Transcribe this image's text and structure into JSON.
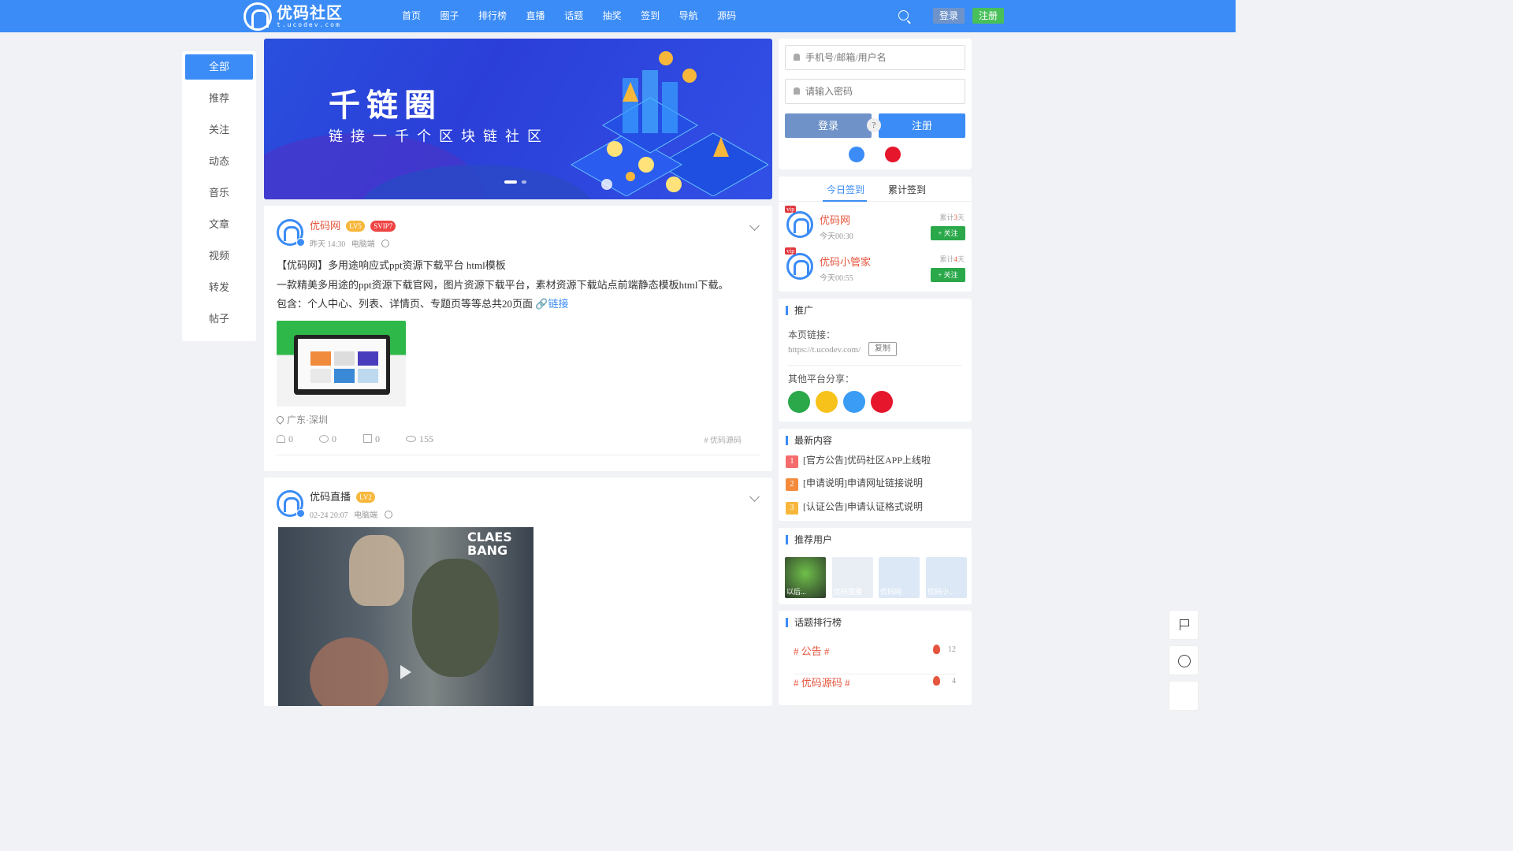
{
  "site": {
    "logo_title": "优码社区",
    "logo_sub": "t.ucodev.com",
    "nav": [
      "首页",
      "圈子",
      "排行榜",
      "直播",
      "话题",
      "抽奖",
      "签到",
      "导航",
      "源码"
    ],
    "login_label": "登录",
    "register_label": "注册",
    "accent": "#3b8cf6"
  },
  "left_nav": {
    "items": [
      "全部",
      "推荐",
      "关注",
      "动态",
      "音乐",
      "文章",
      "视频",
      "转发",
      "帖子"
    ],
    "active": "全部"
  },
  "banner": {
    "title": "千链圈",
    "subtitle": "链接一千个区块链社区"
  },
  "post1": {
    "author": "优码网",
    "level": "LV5",
    "vip": "SVIP7",
    "time": "昨天 14:30",
    "device": "电脑端",
    "line1": "【优码网】多用途响应式ppt资源下载平台 html模板",
    "line2": "一款精美多用途的ppt资源下载官网，图片资源下载平台，素材资源下载站点前端静态模板html下载。",
    "line3": "包含：个人中心、列表、详情页、专题页等等总共20页面",
    "link": "链接",
    "location": "广东·深圳",
    "likes": "0",
    "comments": "0",
    "shares": "0",
    "views": "155",
    "topic": "# 优码源码"
  },
  "post2": {
    "author": "优码直播",
    "level": "LV2",
    "time": "02-24 20:07",
    "device": "电脑端",
    "poster_text_1": "CLAES",
    "poster_text_2": "BANG"
  },
  "login_card": {
    "user_placeholder": "手机号/邮箱/用户名",
    "pass_placeholder": "请输入密码",
    "login": "登录",
    "register": "注册",
    "help": "?"
  },
  "sign_card": {
    "tab_today": "今日签到",
    "tab_total": "累计签到",
    "rows": [
      {
        "name": "优码网",
        "time": "今天00:30",
        "days_prefix": "累计",
        "days": "3",
        "days_suffix": "天",
        "follow": "+ 关注",
        "vip": "vip"
      },
      {
        "name": "优码小管家",
        "time": "今天00:55",
        "days_prefix": "累计",
        "days": "4",
        "days_suffix": "天",
        "follow": "+ 关注",
        "vip": "vip"
      }
    ]
  },
  "promo": {
    "title": "推广",
    "page_link_label": "本页链接：",
    "url": "https://t.ucodev.com/",
    "copy": "复制",
    "share_label": "其他平台分享："
  },
  "latest": {
    "title": "最新内容",
    "items": [
      {
        "num": "1",
        "text": "[官方公告]优码社区APP上线啦"
      },
      {
        "num": "2",
        "text": "[申请说明]申请网址链接说明"
      },
      {
        "num": "3",
        "text": "[认证公告]申请认证格式说明"
      }
    ]
  },
  "users": {
    "title": "推荐用户",
    "items": [
      "以后...",
      "优码直播",
      "优码网",
      "优码小..."
    ]
  },
  "topics": {
    "title": "话题排行榜",
    "items": [
      {
        "name": "# 公告 #",
        "count": "12"
      },
      {
        "name": "# 优码源码 #",
        "count": "4"
      }
    ]
  }
}
